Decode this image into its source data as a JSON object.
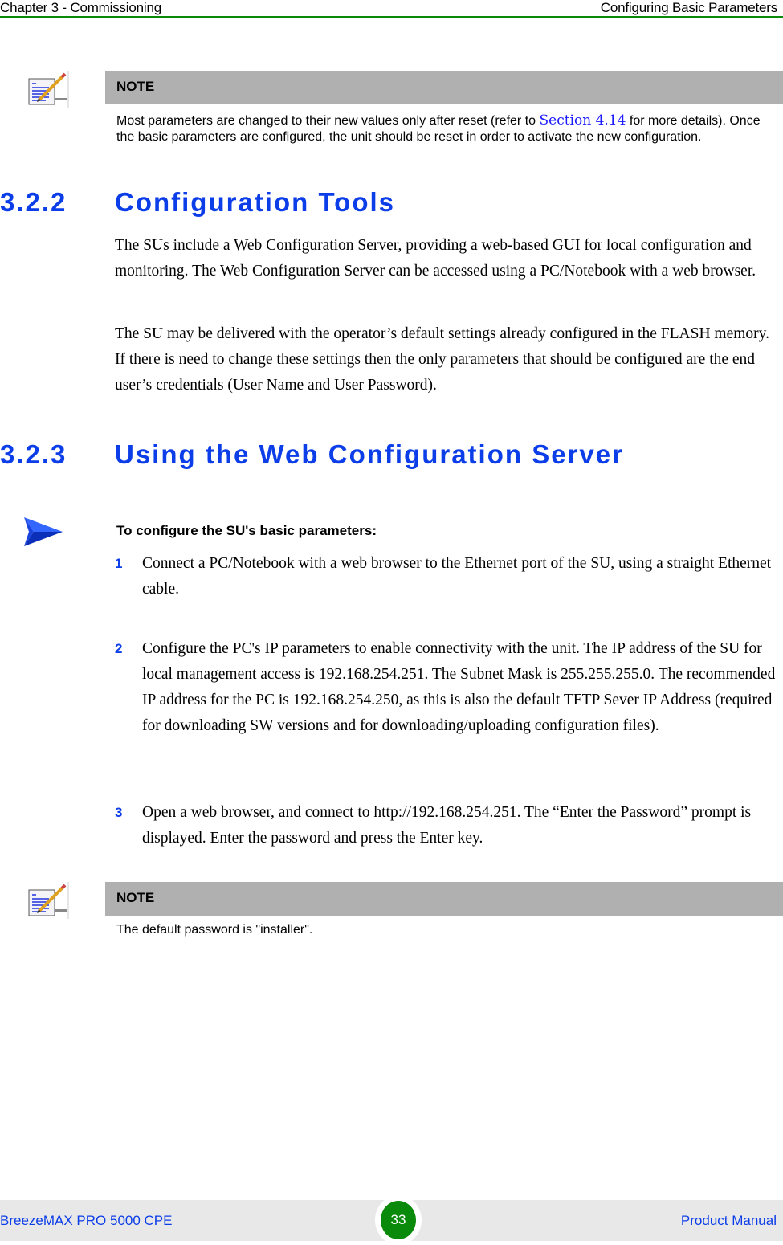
{
  "header": {
    "chapter": "Chapter 3 - Commissioning",
    "section": "Configuring Basic Parameters",
    "rule_color": "#0a8a0a"
  },
  "note1": {
    "icon": "note-pencil-icon",
    "title": "NOTE",
    "text_before_link": "Most parameters are changed to their new values only after reset (refer to ",
    "link": "Section 4.14",
    "text_after_link": " for more details). Once the basic parameters are configured, the unit should be reset in order to activate the new configuration."
  },
  "section_322": {
    "number": "3.2.2",
    "title": "Configuration Tools",
    "paragraphs": [
      "The SUs include a Web Configuration Server, providing a web-based GUI for local configuration and monitoring. The Web Configuration Server can be accessed using a PC/Notebook with a web browser.",
      "The SU may be delivered with the operator’s default settings already configured in the FLASH memory. If there is need to change these settings then the only parameters that should be configured are the end user’s credentials (User Name and User Password)."
    ]
  },
  "section_323": {
    "number": "3.2.3",
    "title": "Using the Web Configuration Server",
    "procedure": {
      "icon": "arrow-right-icon",
      "title": "To configure the SU's basic parameters:"
    },
    "steps": [
      {
        "num": "1",
        "text": "Connect a PC/Notebook with a web browser to the Ethernet port of the SU, using a straight Ethernet cable."
      },
      {
        "num": "2",
        "text": "Configure the PC's IP parameters to enable connectivity with the unit. The IP address of the SU for local management access is 192.168.254.251. The Subnet Mask is 255.255.255.0. The recommended IP address for the PC is 192.168.254.250, as this is also the default TFTP Sever IP Address (required for downloading SW versions and for downloading/uploading configuration files)."
      },
      {
        "num": "3",
        "text": "Open a web browser, and connect to http://192.168.254.251. The “Enter the Password” prompt is displayed. Enter the password and press the Enter key."
      }
    ]
  },
  "note2": {
    "icon": "note-pencil-icon",
    "title": "NOTE",
    "text": "The default password is \"installer\"."
  },
  "footer": {
    "product": "BreezeMAX PRO 5000 CPE",
    "page_number": "33",
    "doc_type": "Product Manual",
    "accent_color": "#0b3de8",
    "badge_color": "#0a8a0a"
  }
}
